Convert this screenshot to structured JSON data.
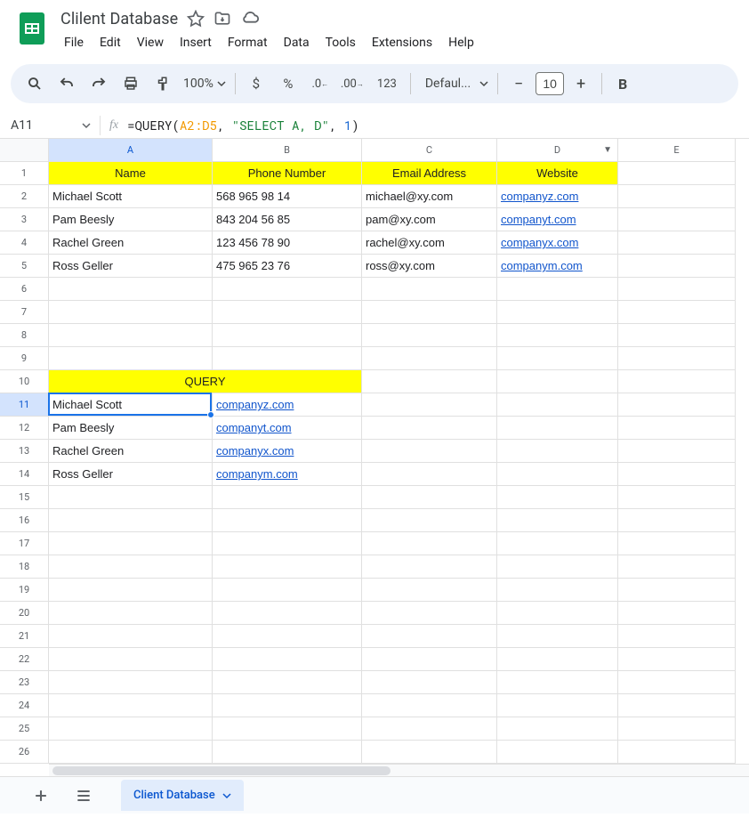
{
  "doc_title": "Clilent Database",
  "menus": [
    "File",
    "Edit",
    "View",
    "Insert",
    "Format",
    "Data",
    "Tools",
    "Extensions",
    "Help"
  ],
  "toolbar": {
    "zoom": "100%",
    "currency": "$",
    "percent": "%",
    "num_fmt": "123",
    "font": "Defaul...",
    "font_size": "10"
  },
  "namebox": "A11",
  "formula": {
    "prefix": "=QUERY(",
    "range": "A2:D5",
    "sep1": ", ",
    "str": "\"SELECT A, D\"",
    "sep2": ", ",
    "num": "1",
    "suffix": ")"
  },
  "columns": [
    "A",
    "B",
    "C",
    "D",
    "E"
  ],
  "headers": {
    "A": "Name",
    "B": "Phone Number",
    "C": "Email Address",
    "D": "Website"
  },
  "rows": [
    {
      "A": "Michael Scott",
      "B": "568 965 98 14",
      "C": "michael@xy.com",
      "D": "companyz.com"
    },
    {
      "A": "Pam Beesly",
      "B": "843 204 56 85",
      "C": "pam@xy.com",
      "D": "companyt.com"
    },
    {
      "A": "Rachel Green",
      "B": "123 456 78 90",
      "C": "rachel@xy.com",
      "D": "companyx.com"
    },
    {
      "A": "Ross Geller",
      "B": "475 965 23 76",
      "C": "ross@xy.com",
      "D": "companym.com"
    }
  ],
  "query_label": "QUERY",
  "query_results": [
    {
      "A": "Michael Scott",
      "B": "companyz.com"
    },
    {
      "A": "Pam Beesly",
      "B": "companyt.com"
    },
    {
      "A": "Rachel Green",
      "B": "companyx.com"
    },
    {
      "A": "Ross Geller",
      "B": "companym.com"
    }
  ],
  "sheet_tab": "Client Database",
  "selected_cell": "A11",
  "column_with_filter": "D"
}
